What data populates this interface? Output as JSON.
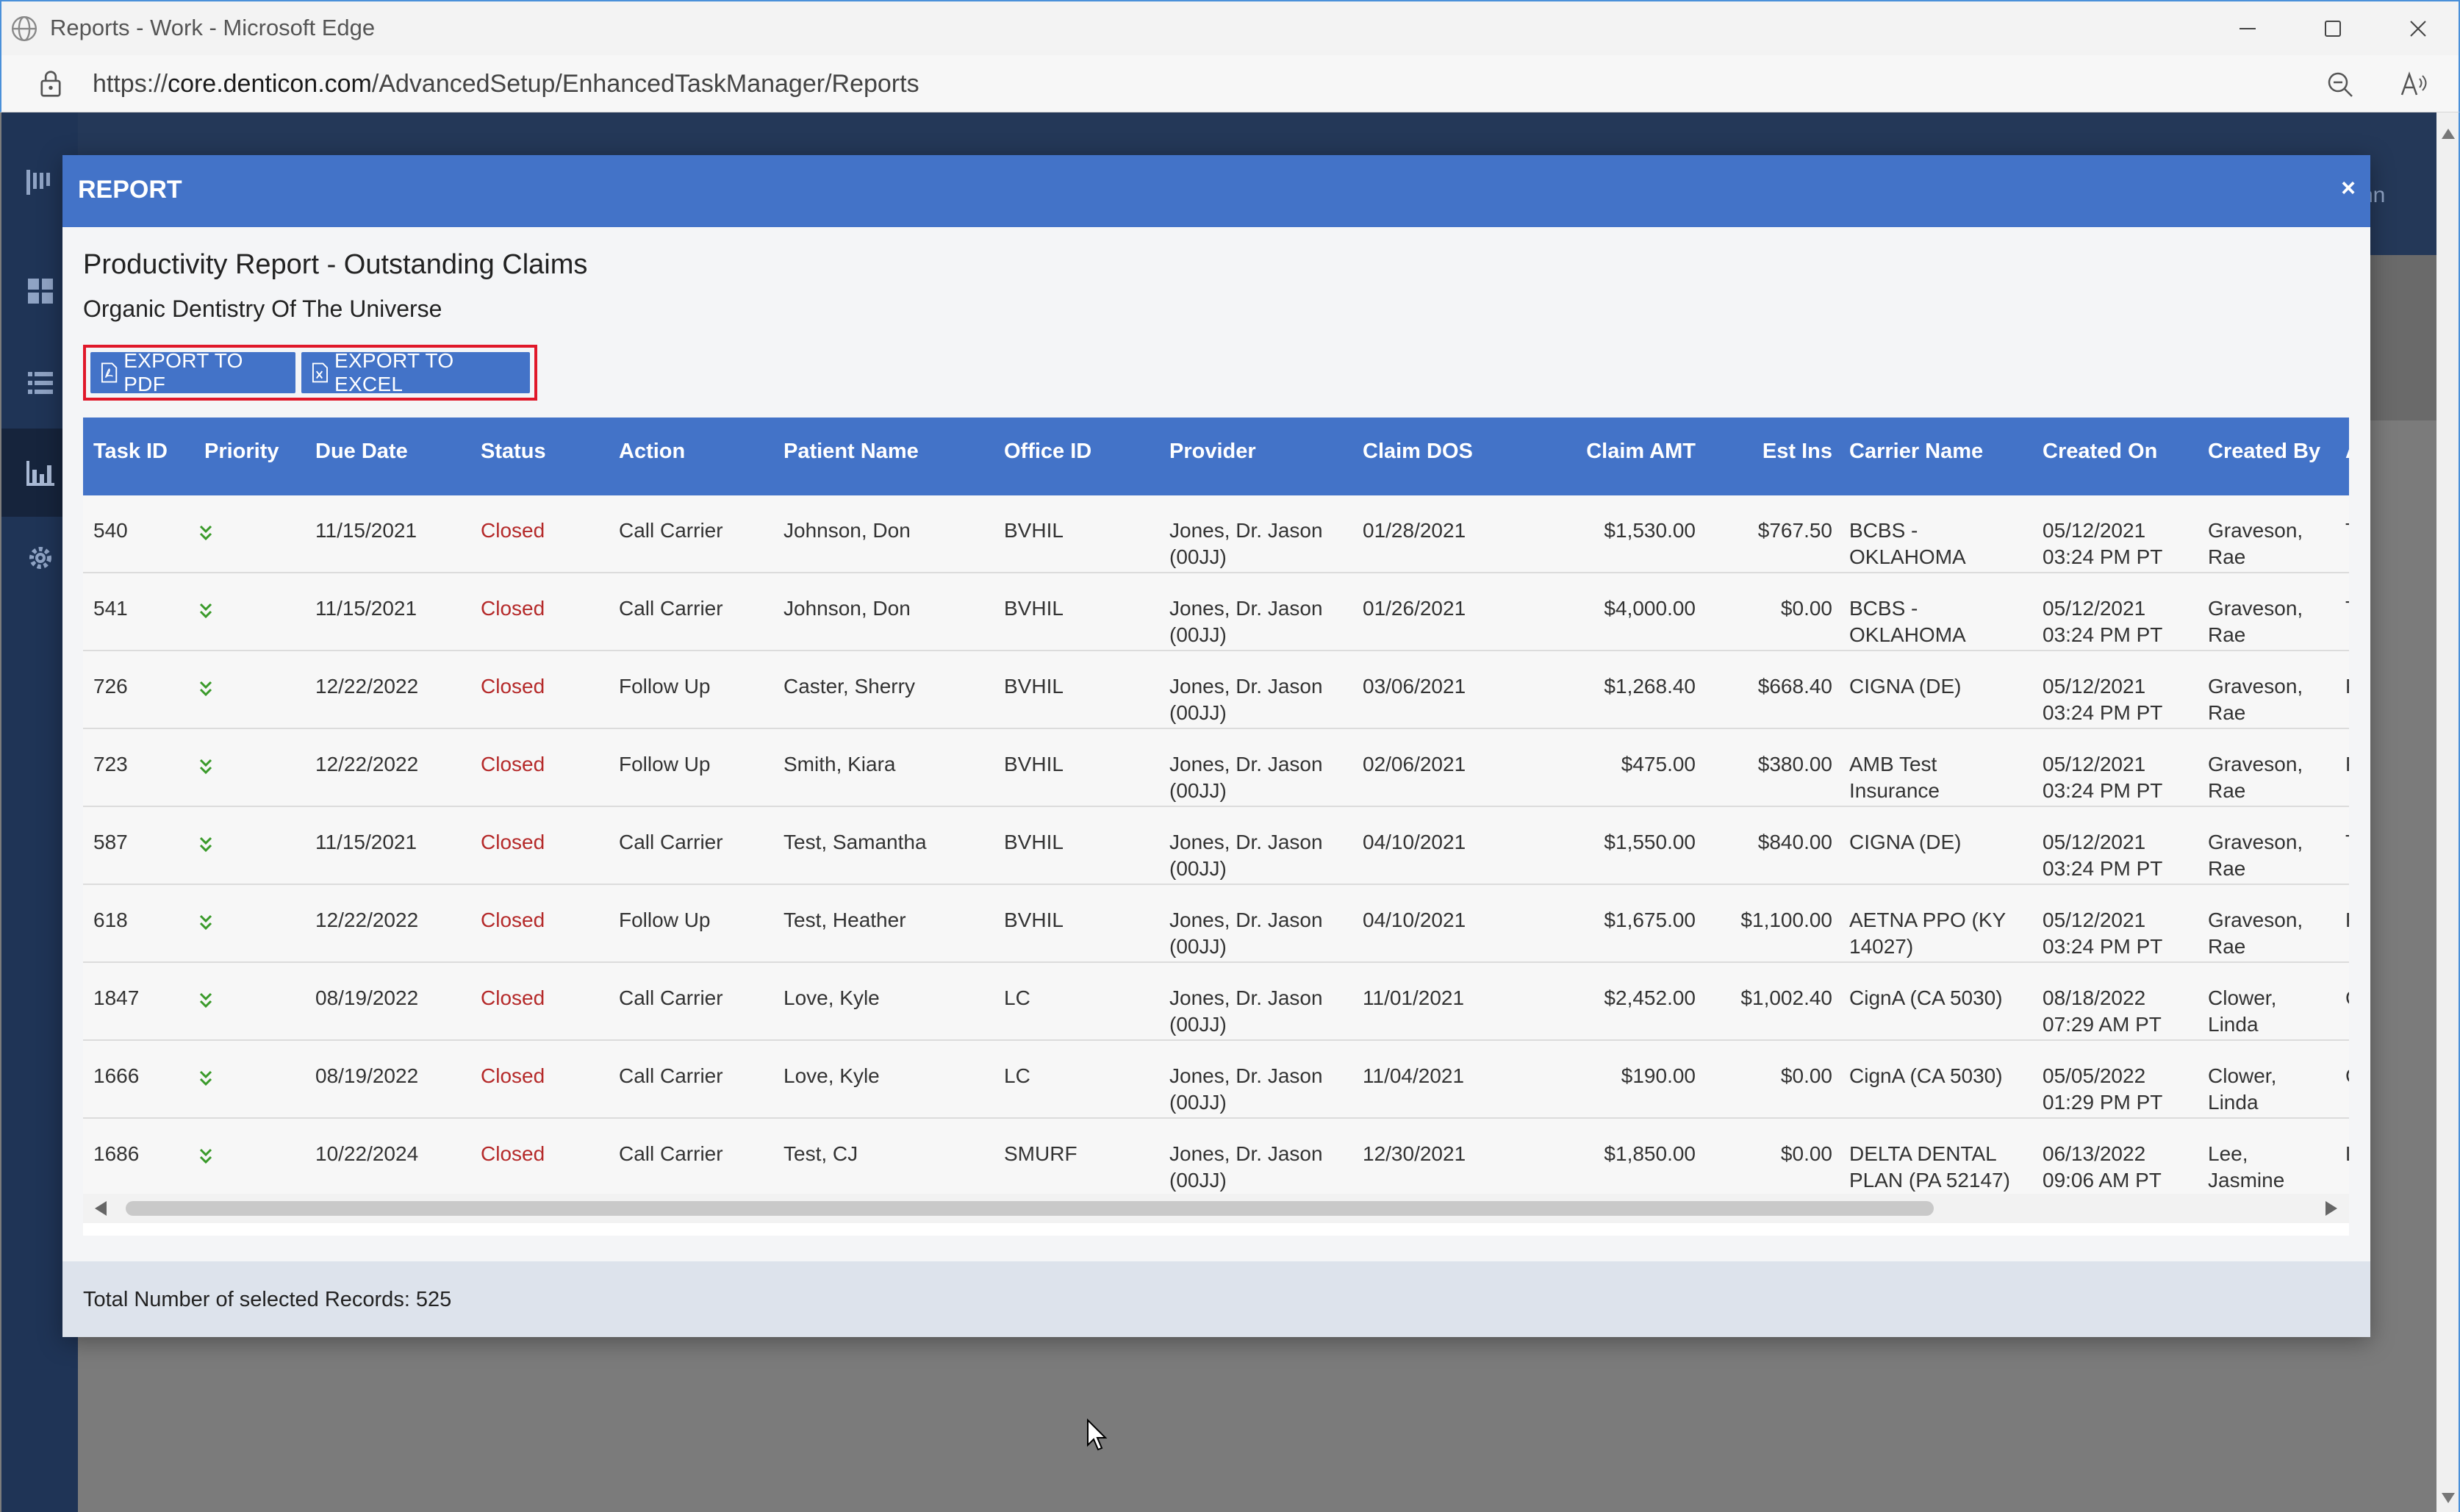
{
  "browser": {
    "window_title": "Reports - Work - Microsoft Edge",
    "url_prefix": "https://",
    "url_host": "core.denticon.com",
    "url_path": "/AdvancedSetup/EnhancedTaskManager/Reports"
  },
  "background": {
    "user_partial": "nn"
  },
  "modal": {
    "title": "REPORT",
    "close": "×",
    "report_title": "Productivity Report - Outstanding Claims",
    "practice_name": "Organic Dentistry Of The Universe",
    "export_pdf": "EXPORT TO PDF",
    "export_excel": "EXPORT TO EXCEL",
    "footer": "Total Number of selected Records: 525"
  },
  "table": {
    "columns": [
      "Task ID",
      "Priority",
      "Due Date",
      "Status",
      "Action",
      "Patient Name",
      "Office ID",
      "Provider",
      "Claim DOS",
      "Claim AMT",
      "Est Ins",
      "Carrier Name",
      "Created On",
      "Created By",
      "As"
    ],
    "rows": [
      {
        "task_id": "540",
        "due": "11/15/2021",
        "status": "Closed",
        "action": "Call Carrier",
        "patient": "Johnson, Don",
        "office": "BVHIL",
        "provider1": "Jones, Dr. Jason",
        "provider2": "(00JJ)",
        "dos": "01/28/2021",
        "amt": "$1,530.00",
        "est": "$767.50",
        "carrier1": "BCBS -",
        "carrier2": "OKLAHOMA",
        "created1": "05/12/2021",
        "created2": "03:24 PM PT",
        "by1": "Graveson,",
        "by2": "Rae",
        "as": "Tr"
      },
      {
        "task_id": "541",
        "due": "11/15/2021",
        "status": "Closed",
        "action": "Call Carrier",
        "patient": "Johnson, Don",
        "office": "BVHIL",
        "provider1": "Jones, Dr. Jason",
        "provider2": "(00JJ)",
        "dos": "01/26/2021",
        "amt": "$4,000.00",
        "est": "$0.00",
        "carrier1": "BCBS -",
        "carrier2": "OKLAHOMA",
        "created1": "05/12/2021",
        "created2": "03:24 PM PT",
        "by1": "Graveson,",
        "by2": "Rae",
        "as": "Tr"
      },
      {
        "task_id": "726",
        "due": "12/22/2022",
        "status": "Closed",
        "action": "Follow Up",
        "patient": "Caster, Sherry",
        "office": "BVHIL",
        "provider1": "Jones, Dr. Jason",
        "provider2": "(00JJ)",
        "dos": "03/06/2021",
        "amt": "$1,268.40",
        "est": "$668.40",
        "carrier1": "CIGNA (DE)",
        "carrier2": "",
        "created1": "05/12/2021",
        "created2": "03:24 PM PT",
        "by1": "Graveson,",
        "by2": "Rae",
        "as": "Pr"
      },
      {
        "task_id": "723",
        "due": "12/22/2022",
        "status": "Closed",
        "action": "Follow Up",
        "patient": "Smith, Kiara",
        "office": "BVHIL",
        "provider1": "Jones, Dr. Jason",
        "provider2": "(00JJ)",
        "dos": "02/06/2021",
        "amt": "$475.00",
        "est": "$380.00",
        "carrier1": "AMB Test",
        "carrier2": "Insurance",
        "created1": "05/12/2021",
        "created2": "03:24 PM PT",
        "by1": "Graveson,",
        "by2": "Rae",
        "as": "Pr"
      },
      {
        "task_id": "587",
        "due": "11/15/2021",
        "status": "Closed",
        "action": "Call Carrier",
        "patient": "Test, Samantha",
        "office": "BVHIL",
        "provider1": "Jones, Dr. Jason",
        "provider2": "(00JJ)",
        "dos": "04/10/2021",
        "amt": "$1,550.00",
        "est": "$840.00",
        "carrier1": "CIGNA (DE)",
        "carrier2": "",
        "created1": "05/12/2021",
        "created2": "03:24 PM PT",
        "by1": "Graveson,",
        "by2": "Rae",
        "as": "Tr"
      },
      {
        "task_id": "618",
        "due": "12/22/2022",
        "status": "Closed",
        "action": "Follow Up",
        "patient": "Test, Heather",
        "office": "BVHIL",
        "provider1": "Jones, Dr. Jason",
        "provider2": "(00JJ)",
        "dos": "04/10/2021",
        "amt": "$1,675.00",
        "est": "$1,100.00",
        "carrier1": "AETNA PPO (KY",
        "carrier2": "14027)",
        "created1": "05/12/2021",
        "created2": "03:24 PM PT",
        "by1": "Graveson,",
        "by2": "Rae",
        "as": "Pr"
      },
      {
        "task_id": "1847",
        "due": "08/19/2022",
        "status": "Closed",
        "action": "Call Carrier",
        "patient": "Love, Kyle",
        "office": "LC",
        "provider1": "Jones, Dr. Jason",
        "provider2": "(00JJ)",
        "dos": "11/01/2021",
        "amt": "$2,452.00",
        "est": "$1,002.40",
        "carrier1": "CignA (CA 5030)",
        "carrier2": "",
        "created1": "08/18/2022",
        "created2": "07:29 AM PT",
        "by1": "Clower,",
        "by2": "Linda",
        "as": "Ca"
      },
      {
        "task_id": "1666",
        "due": "08/19/2022",
        "status": "Closed",
        "action": "Call Carrier",
        "patient": "Love, Kyle",
        "office": "LC",
        "provider1": "Jones, Dr. Jason",
        "provider2": "(00JJ)",
        "dos": "11/04/2021",
        "amt": "$190.00",
        "est": "$0.00",
        "carrier1": "CignA (CA 5030)",
        "carrier2": "",
        "created1": "05/05/2022",
        "created2": "01:29 PM PT",
        "by1": "Clower,",
        "by2": "Linda",
        "as": "Cl"
      },
      {
        "task_id": "1686",
        "due": "10/22/2024",
        "status": "Closed",
        "action": "Call Carrier",
        "patient": "Test, CJ",
        "office": "SMURF",
        "provider1": "Jones, Dr. Jason",
        "provider2": "(00JJ)",
        "dos": "12/30/2021",
        "amt": "$1,850.00",
        "est": "$0.00",
        "carrier1": "DELTA DENTAL",
        "carrier2": "PLAN (PA 52147)",
        "created1": "06/13/2022",
        "created2": "09:06 AM PT",
        "by1": "Lee,",
        "by2": "Jasmine",
        "as": "Le"
      }
    ]
  },
  "colors": {
    "primary": "#4373c8",
    "status_closed": "#b52a2a",
    "priority_low": "#3a9a2a",
    "export_highlight": "#e0182a"
  }
}
